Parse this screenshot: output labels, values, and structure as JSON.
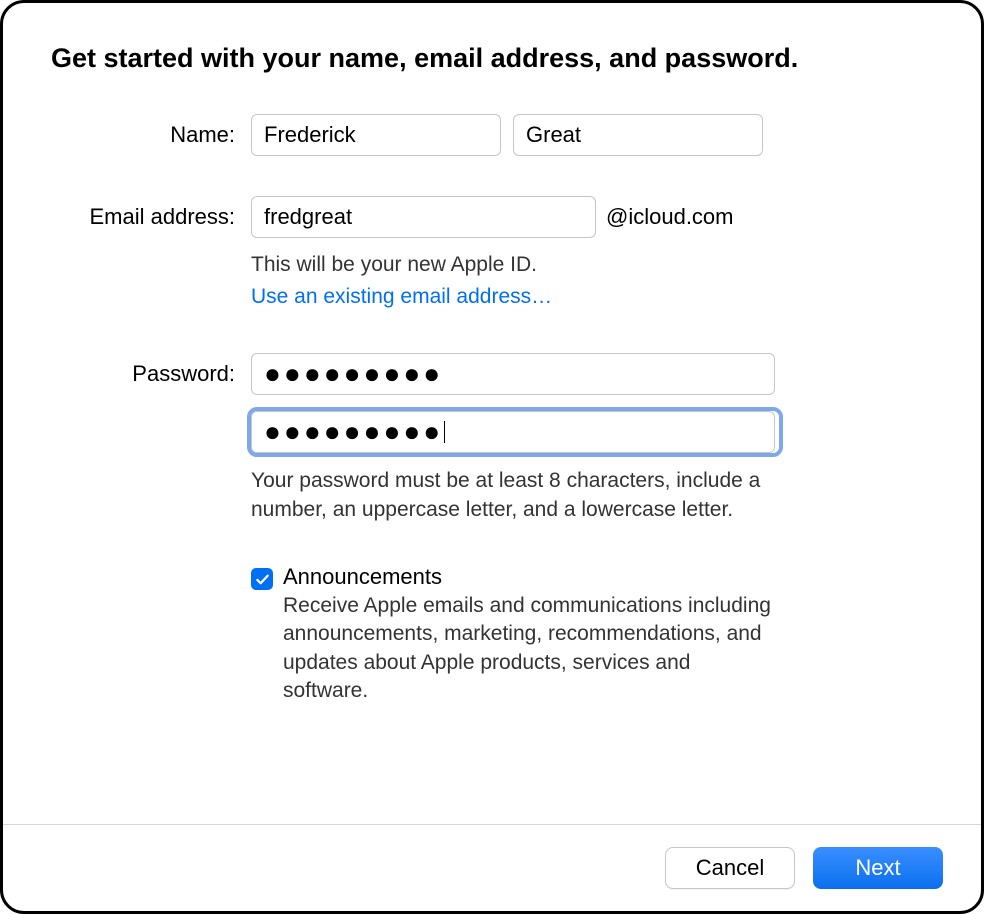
{
  "title": "Get started with your name, email address, and password.",
  "labels": {
    "name": "Name:",
    "email": "Email address:",
    "password": "Password:"
  },
  "name": {
    "first": "Frederick",
    "last": "Great"
  },
  "email": {
    "local": "fredgreat",
    "domain": "@icloud.com",
    "helper": "This will be your new Apple ID.",
    "link": "Use an existing email address…"
  },
  "password": {
    "value_masked": "●●●●●●●●●",
    "confirm_masked": "●●●●●●●●●",
    "helper": "Your password must be at least 8 characters, include a number, an uppercase letter, and a lowercase letter."
  },
  "announcements": {
    "checked": true,
    "title": "Announcements",
    "desc": "Receive Apple emails and communications including announcements, marketing, recommendations, and updates about Apple products, services and software."
  },
  "buttons": {
    "cancel": "Cancel",
    "next": "Next"
  }
}
